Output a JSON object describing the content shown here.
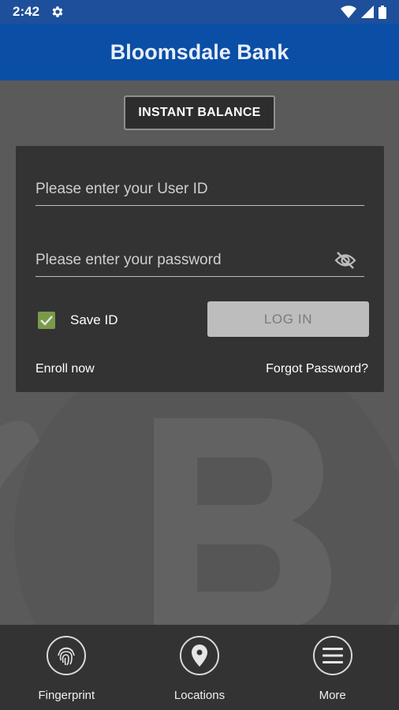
{
  "status_bar": {
    "time": "2:42"
  },
  "app_bar": {
    "title": "Bloomsdale Bank"
  },
  "instant_balance": {
    "label": "INSTANT BALANCE"
  },
  "login": {
    "user_id_placeholder": "Please enter your User ID",
    "password_placeholder": "Please enter your password",
    "save_id_label": "Save ID",
    "save_id_checked": true,
    "login_label": "LOG IN",
    "enroll_label": "Enroll now",
    "forgot_label": "Forgot Password?"
  },
  "bottom_nav": {
    "items": [
      {
        "label": "Fingerprint",
        "icon": "fingerprint-icon"
      },
      {
        "label": "Locations",
        "icon": "location-pin-icon"
      },
      {
        "label": "More",
        "icon": "menu-icon"
      }
    ]
  },
  "colors": {
    "app_bar": "#0a4ea6",
    "status_bar": "#1e4f9a",
    "background": "#5a5a5a",
    "card": "#333333",
    "checkbox": "#7a9a4b"
  }
}
